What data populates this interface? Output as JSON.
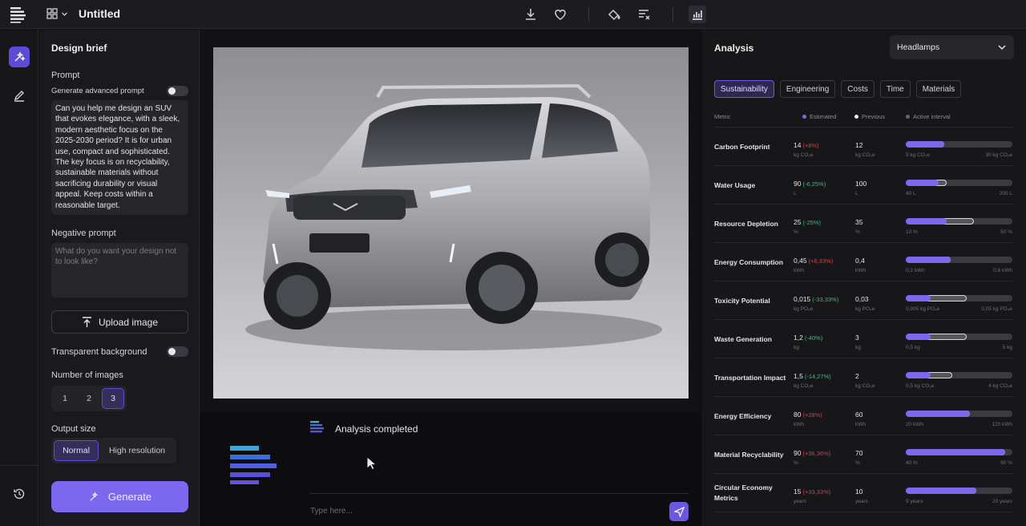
{
  "app": {
    "title": "Untitled"
  },
  "colors": {
    "accent": "#7b68ee",
    "negative": "#e03c3c",
    "positive": "#2ec27e"
  },
  "left": {
    "heading": "Design brief",
    "prompt_label": "Prompt",
    "advanced_label": "Generate advanced prompt",
    "prompt_text": "Can you help me design an SUV that evokes elegance, with a sleek, modern aesthetic focus on the 2025-2030 period? It is for urban use, compact and sophisticated.\nThe key focus is on recyclability, sustainable materials without sacrificing durability or visual appeal. Keep costs within a reasonable target.",
    "negative_label": "Negative prompt",
    "negative_placeholder": "What do you want your design not to look like?",
    "upload_label": "Upload image",
    "transparent_label": "Transparent background",
    "num_images_label": "Number of images",
    "num_options": [
      "1",
      "2",
      "3"
    ],
    "num_selected": "3",
    "output_label": "Output size",
    "output_options": [
      "Normal",
      "High resolution"
    ],
    "output_selected": "Normal",
    "generate_label": "Generate"
  },
  "chat": {
    "status": "Analysis completed",
    "placeholder": "Type here..."
  },
  "analysis": {
    "title": "Analysis",
    "component": "Headlamps",
    "tabs": [
      "Sustainability",
      "Engineering",
      "Costs",
      "Time",
      "Materials"
    ],
    "active_tab": "Sustainability",
    "legend": {
      "metric": "Metric",
      "estimated": "Estimated",
      "previous": "Previous",
      "interval": "Active interval"
    },
    "metrics": [
      {
        "name": "Carbon Footprint",
        "est": "14",
        "chg": "(+8%)",
        "dir": "up",
        "unit": "kg CO₂e",
        "prev": "12",
        "prev_unit": "kg CO₂e",
        "min": "5 kg CO₂e",
        "max": "30 kg CO₂e",
        "est_frac": 0.36,
        "int_frac": 0.36
      },
      {
        "name": "Water Usage",
        "est": "90",
        "chg": "(-6,25%)",
        "dir": "down",
        "unit": "L",
        "prev": "100",
        "prev_unit": "L",
        "min": "40 L",
        "max": "200 L",
        "est_frac": 0.31,
        "int_frac": 0.38
      },
      {
        "name": "Resource Depletion",
        "est": "25",
        "chg": "(-25%)",
        "dir": "down",
        "unit": "%",
        "prev": "35",
        "prev_unit": "%",
        "min": "10 %",
        "max": "50 %",
        "est_frac": 0.38,
        "int_frac": 0.64
      },
      {
        "name": "Energy Consumption",
        "est": "0,45",
        "chg": "(+8,33%)",
        "dir": "up",
        "unit": "kWh",
        "prev": "0,4",
        "prev_unit": "kWh",
        "min": "0,2 kWh",
        "max": "0,8 kWh",
        "est_frac": 0.42,
        "int_frac": 0.42
      },
      {
        "name": "Toxicity Potential",
        "est": "0,015",
        "chg": "(-33,33%)",
        "dir": "down",
        "unit": "kg PO₄e",
        "prev": "0,03",
        "prev_unit": "kg PO₄e",
        "min": "0,005 kg PO₄e",
        "max": "0,05 kg PO₄e",
        "est_frac": 0.23,
        "int_frac": 0.57
      },
      {
        "name": "Waste Generation",
        "est": "1,2",
        "chg": "(-40%)",
        "dir": "down",
        "unit": "kg",
        "prev": "3",
        "prev_unit": "kg",
        "min": "0,5 kg",
        "max": "5 kg",
        "est_frac": 0.23,
        "int_frac": 0.57
      },
      {
        "name": "Transportation Impact",
        "est": "1,5",
        "chg": "(-14,27%)",
        "dir": "down",
        "unit": "kg CO₂e",
        "prev": "2",
        "prev_unit": "kg CO₂e",
        "min": "0,5 kg CO₂e",
        "max": "4 kg CO₂e",
        "est_frac": 0.23,
        "int_frac": 0.44
      },
      {
        "name": "Energy Efficiency",
        "est": "80",
        "chg": "(+28%)",
        "dir": "up",
        "unit": "kWh",
        "prev": "60",
        "prev_unit": "kWh",
        "min": "20 kWh",
        "max": "120 kWh",
        "est_frac": 0.6,
        "int_frac": 0.4
      },
      {
        "name": "Material Recyclability",
        "est": "90",
        "chg": "(+36,36%)",
        "dir": "up",
        "unit": "%",
        "prev": "70",
        "prev_unit": "%",
        "min": "40 %",
        "max": "90 %",
        "est_frac": 0.93,
        "int_frac": 0.93
      },
      {
        "name": "Circular Economy Metrics",
        "est": "15",
        "chg": "(+33,33%)",
        "dir": "up",
        "unit": "years",
        "prev": "10",
        "prev_unit": "years",
        "min": "5 years",
        "max": "20 years",
        "est_frac": 0.66,
        "int_frac": 0.66
      }
    ]
  }
}
